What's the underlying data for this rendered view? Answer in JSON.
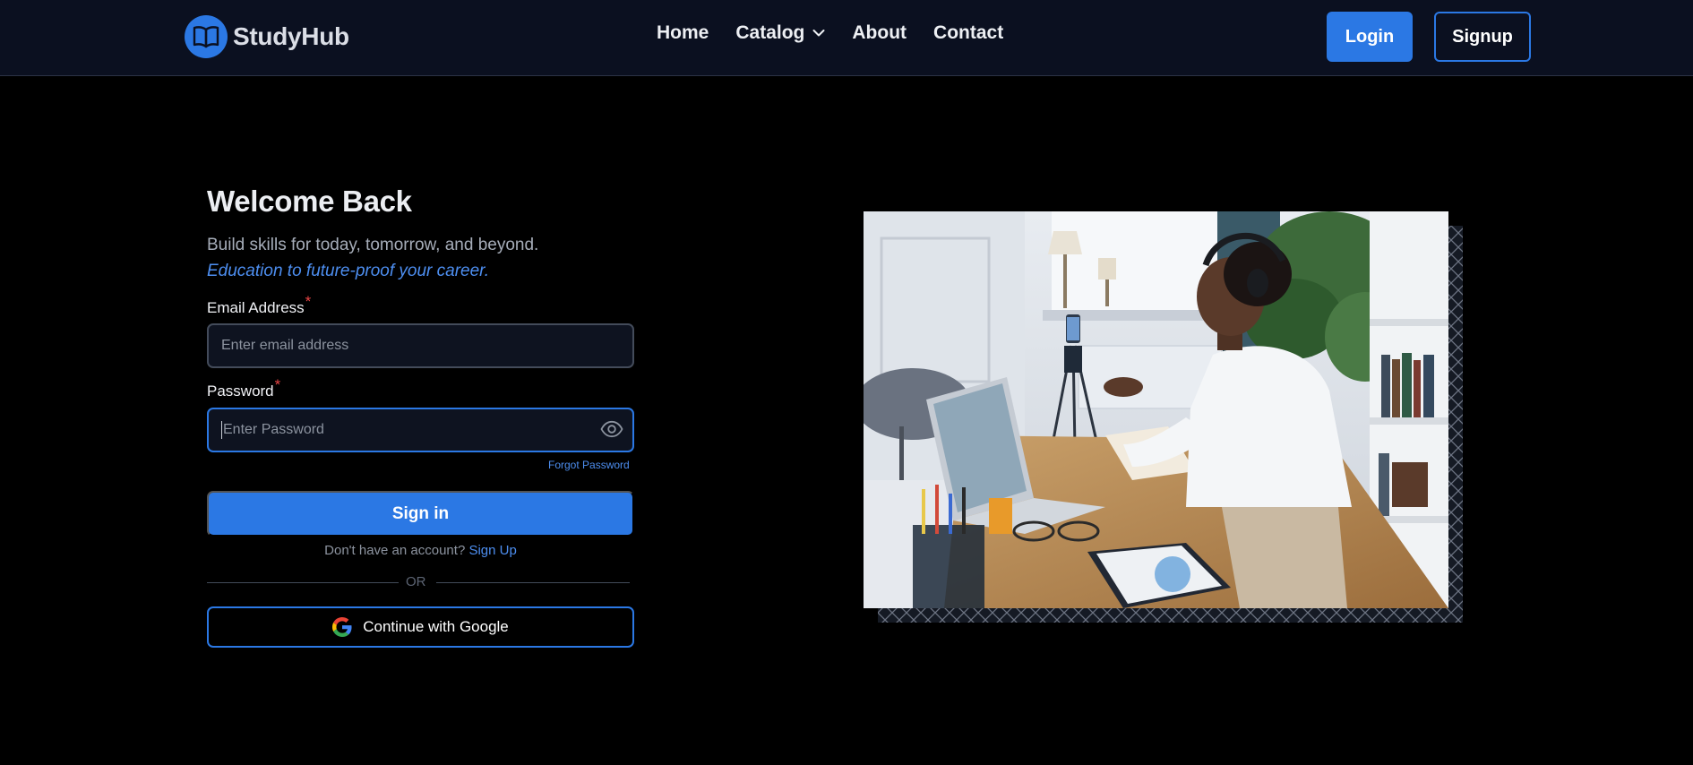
{
  "brand": {
    "name": "StudyHub"
  },
  "nav": {
    "links": [
      {
        "label": "Home"
      },
      {
        "label": "Catalog"
      },
      {
        "label": "About"
      },
      {
        "label": "Contact"
      }
    ],
    "login_label": "Login",
    "signup_label": "Signup"
  },
  "form": {
    "title": "Welcome Back",
    "subtitle": "Build skills for today, tomorrow, and beyond.",
    "tagline": "Education to future-proof your career.",
    "email_label": "Email Address",
    "email_placeholder": "Enter email address",
    "email_value": "",
    "password_label": "Password",
    "password_placeholder": "Enter Password",
    "password_value": "",
    "required_mark": "*",
    "forgot_label": "Forgot Password",
    "signin_label": "Sign in",
    "no_account_text": "Don't have an account?",
    "signup_link": "Sign Up",
    "or_text": "OR",
    "google_label": "Continue with Google"
  },
  "icons": {
    "logo": "open-book-icon",
    "catalog": "chevron-down-icon",
    "password_toggle": "eye-icon",
    "google": "google-g-icon"
  },
  "colors": {
    "accent": "#2b78e4",
    "link": "#4d8ef0",
    "required": "#e84545",
    "navbar_bg": "#0b1020",
    "page_bg": "#000000"
  }
}
